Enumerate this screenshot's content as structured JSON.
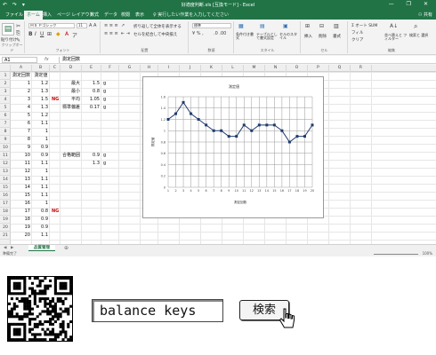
{
  "window": {
    "title": "好適度判断.xls [互換モード] - Excel",
    "quick_access": "↶ ↷ ▾",
    "controls": "— ❐ ✕"
  },
  "tabs": [
    {
      "label": "ファイル"
    },
    {
      "label": "ホーム"
    },
    {
      "label": "挿入"
    },
    {
      "label": "ページ レイアウト"
    },
    {
      "label": "数式"
    },
    {
      "label": "データ"
    },
    {
      "label": "校閲"
    },
    {
      "label": "表示"
    }
  ],
  "tell_me": "♀ 実行したい作業を入力してください",
  "share": "⚇ 共有",
  "ribbon": {
    "paste": "貼り付け",
    "clipboard": "クリップボード",
    "font_name": "ＭＳ Ｐゴシック",
    "font_size": "11",
    "font_group": "フォント",
    "wrap_text": "折り返して全体を表示する",
    "merge_center": "セルを結合して中央揃え",
    "align_group": "配置",
    "number_format": "標準",
    "number_group": "数値",
    "cond_format": "条件付き書式",
    "as_table": "テーブルとして書式設定",
    "cell_style": "セルのスタイル",
    "style_group": "スタイル",
    "insert": "挿入",
    "delete": "削除",
    "format": "書式",
    "cell_group": "セル",
    "autosum": "Σ オート SUM",
    "fill": "フィル",
    "clear": "クリア",
    "sort_filter": "並べ替えと フィルター",
    "find_select": "検索と 選択",
    "edit_group": "編集"
  },
  "formula_bar": {
    "name_box": "A1",
    "fx": "fx",
    "value": "測定回数"
  },
  "columns": [
    "A",
    "B",
    "C",
    "D",
    "E",
    "F",
    "G",
    "H",
    "I",
    "J",
    "K",
    "L",
    "M",
    "N",
    "O",
    "P",
    "Q",
    "R"
  ],
  "rows": [
    "1",
    "2",
    "3",
    "4",
    "5",
    "6",
    "7",
    "8",
    "9",
    "10",
    "11",
    "12",
    "13",
    "14",
    "15",
    "16",
    "17",
    "18",
    "19",
    "20",
    "21"
  ],
  "table": {
    "header_count": "測定回数",
    "header_value": "測定値",
    "rows": [
      {
        "n": "1",
        "v": "1.2",
        "flag": ""
      },
      {
        "n": "2",
        "v": "1.3",
        "flag": ""
      },
      {
        "n": "3",
        "v": "1.5",
        "flag": "NG"
      },
      {
        "n": "4",
        "v": "1.3",
        "flag": ""
      },
      {
        "n": "5",
        "v": "1.2",
        "flag": ""
      },
      {
        "n": "6",
        "v": "1.1",
        "flag": ""
      },
      {
        "n": "7",
        "v": "1",
        "flag": ""
      },
      {
        "n": "8",
        "v": "1",
        "flag": ""
      },
      {
        "n": "9",
        "v": "0.9",
        "flag": ""
      },
      {
        "n": "10",
        "v": "0.9",
        "flag": ""
      },
      {
        "n": "11",
        "v": "1.1",
        "flag": ""
      },
      {
        "n": "12",
        "v": "1",
        "flag": ""
      },
      {
        "n": "13",
        "v": "1.1",
        "flag": ""
      },
      {
        "n": "14",
        "v": "1.1",
        "flag": ""
      },
      {
        "n": "15",
        "v": "1.1",
        "flag": ""
      },
      {
        "n": "16",
        "v": "1",
        "flag": ""
      },
      {
        "n": "17",
        "v": "0.8",
        "flag": "NG"
      },
      {
        "n": "18",
        "v": "0.9",
        "flag": ""
      },
      {
        "n": "19",
        "v": "0.9",
        "flag": ""
      },
      {
        "n": "20",
        "v": "1.1",
        "flag": ""
      }
    ]
  },
  "stats": [
    {
      "label": "最大",
      "value": "1.5",
      "unit": "g"
    },
    {
      "label": "最小",
      "value": "0.8",
      "unit": "g"
    },
    {
      "label": "平均",
      "value": "1.05",
      "unit": "g"
    },
    {
      "label": "標準偏差",
      "value": "0.17",
      "unit": "g"
    }
  ],
  "pass_range": {
    "label": "合格範囲",
    "low": "0.9",
    "low_unit": "g",
    "high": "1.3",
    "high_unit": "g"
  },
  "chart_data": {
    "type": "line",
    "title": "測定値",
    "xlabel": "測定回数",
    "ylabel": "測定値",
    "x": [
      1,
      2,
      3,
      4,
      5,
      6,
      7,
      8,
      9,
      10,
      11,
      12,
      13,
      14,
      15,
      16,
      17,
      18,
      19,
      20
    ],
    "series": [
      {
        "name": "測定値",
        "values": [
          1.2,
          1.3,
          1.5,
          1.3,
          1.2,
          1.1,
          1,
          1,
          0.9,
          0.9,
          1.1,
          1,
          1.1,
          1.1,
          1.1,
          1,
          0.8,
          0.9,
          0.9,
          1.1
        ]
      }
    ],
    "ylim": [
      0,
      1.6
    ],
    "yticks": [
      "0",
      "0.2",
      "0.4",
      "0.6",
      "0.8",
      "1",
      "1.2",
      "1.4",
      "1.6"
    ],
    "grid": true
  },
  "sheet_tab": "品質管理",
  "status": {
    "ready": "準備完了",
    "zoom": "100%"
  },
  "search": {
    "value": "balance keys",
    "button": "検索"
  }
}
